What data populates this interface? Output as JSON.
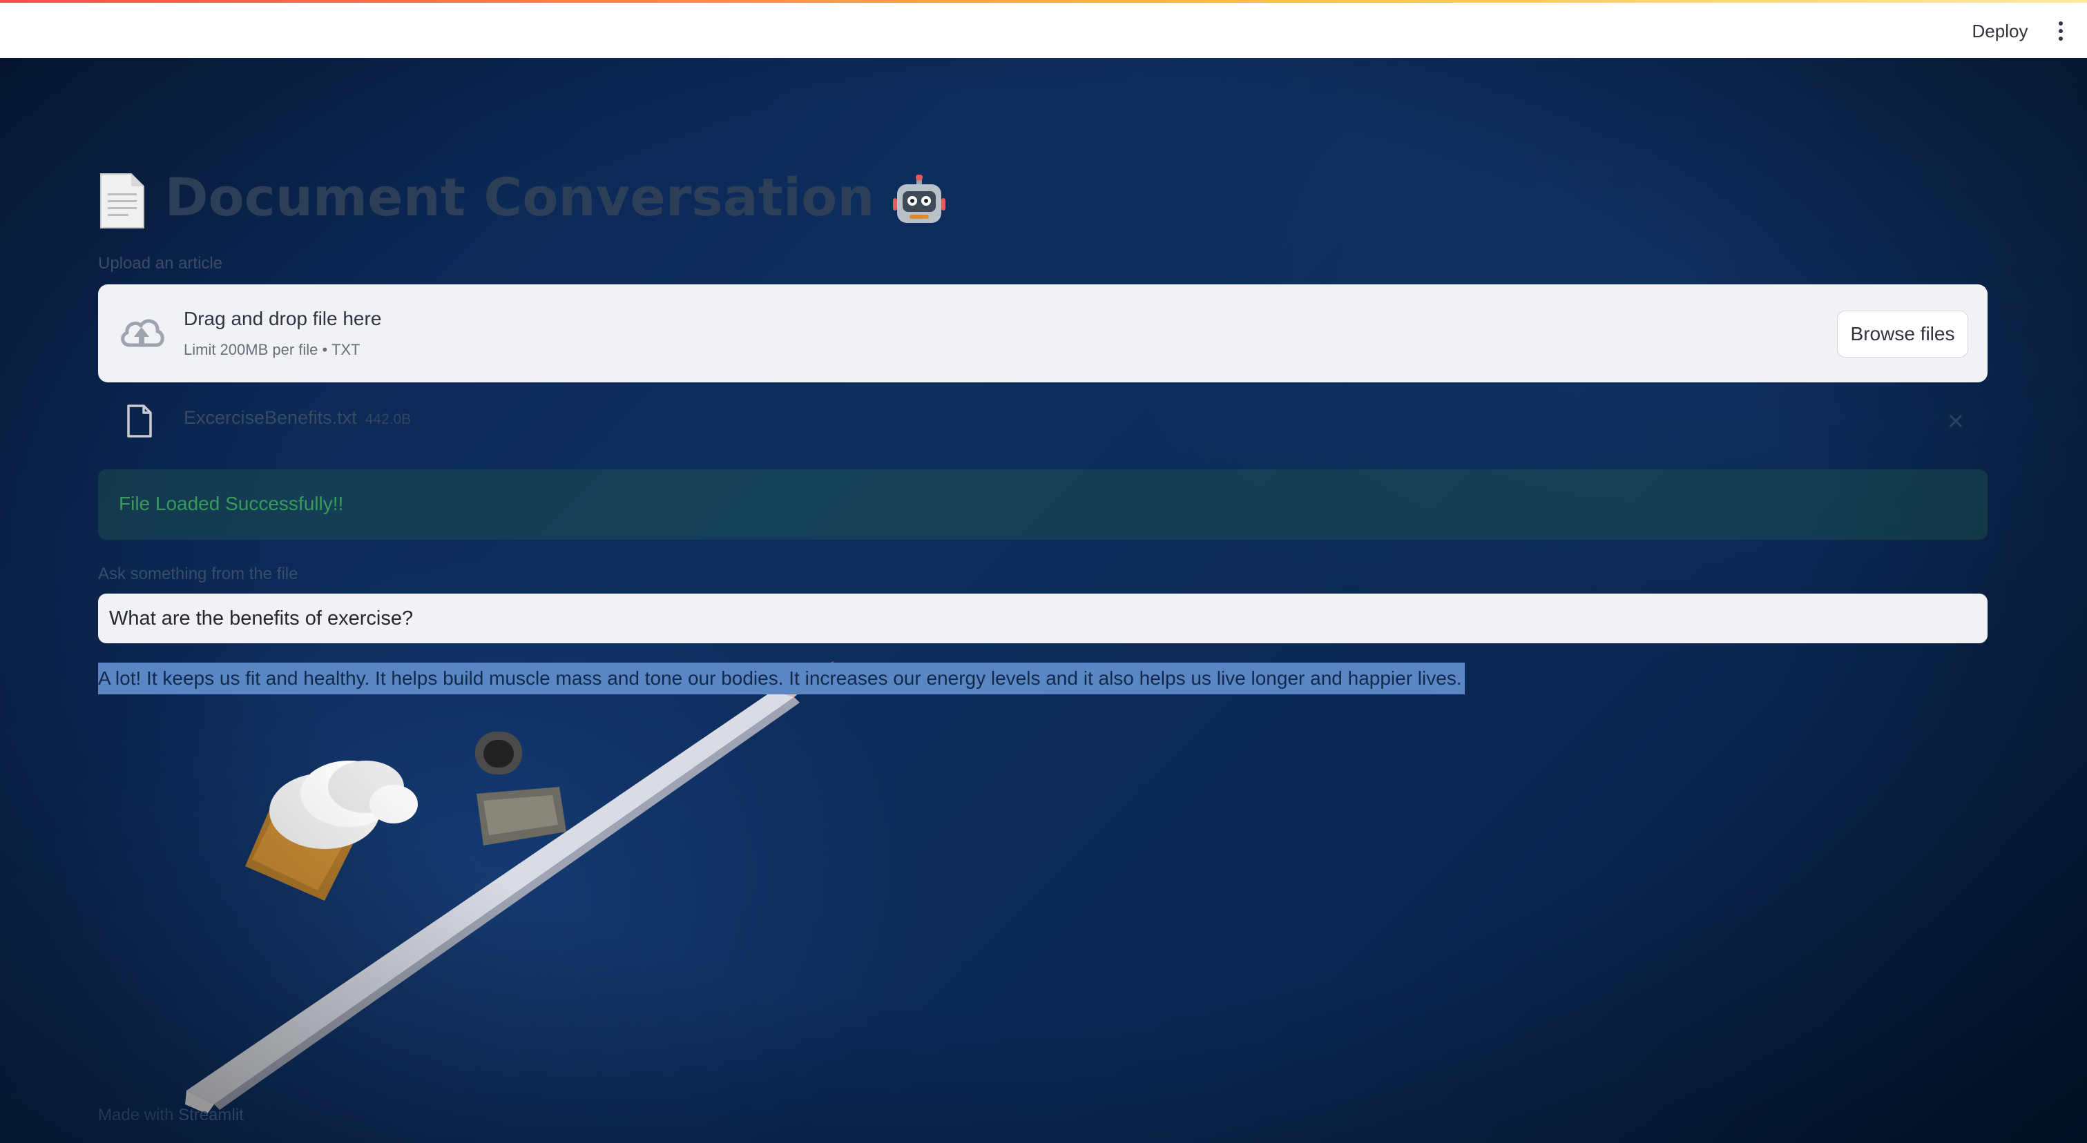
{
  "header": {
    "deploy_label": "Deploy",
    "menu_icon": "vertical-dots-icon"
  },
  "main": {
    "title": {
      "text": "Document Conversation",
      "leading_icon": "document-emoji",
      "trailing_icon": "robot-emoji"
    },
    "uploader": {
      "label": "Upload an article",
      "drop_text": "Drag and drop file here",
      "limit_text": "Limit 200MB per file • TXT",
      "browse_label": "Browse files",
      "icon": "cloud-upload-icon"
    },
    "uploaded_file": {
      "name": "ExcerciseBenefits.txt",
      "size": "442.0B",
      "icon": "file-icon",
      "remove_icon": "close-icon"
    },
    "alert": {
      "text": "File Loaded Successfully!!",
      "color": "#3a9a5a"
    },
    "question": {
      "label": "Ask something from the file",
      "value": "What are the benefits of exercise?"
    },
    "answer": {
      "text": "A lot! It keeps us fit and healthy. It helps build muscle mass and tone our bodies. It increases our energy levels and it also helps us live longer and happier lives.",
      "highlight_color": "#5b86c4"
    }
  },
  "footer": {
    "prefix": "Made with",
    "brand": "Streamlit"
  },
  "colors": {
    "background": "#0c2a55",
    "accent_gradient_start": "#ff4b4b",
    "accent_gradient_end": "#ffbd45"
  }
}
